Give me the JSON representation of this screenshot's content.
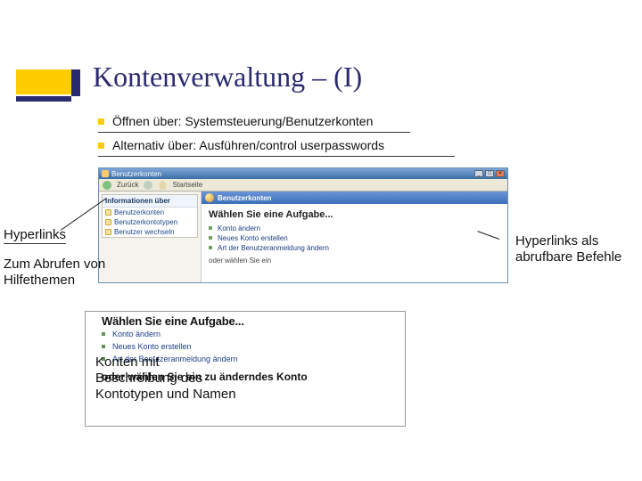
{
  "title": "Kontenverwaltung – (I)",
  "bullets": {
    "b1": "Öffnen über: Systemsteuerung/Benutzerkonten",
    "b2": "Alternativ über: Ausführen/control userpasswords"
  },
  "win1": {
    "title": "Benutzerkonten",
    "toolbar": {
      "back": "Zurück",
      "home": "Startseite"
    },
    "side": {
      "header": "Informationen über",
      "items": [
        "Benutzerkonten",
        "Benutzerkontotypen",
        "Benutzer wechseln"
      ]
    },
    "mainHeader": "Benutzerkonten",
    "tasksHeader": "Wählen Sie eine Aufgabe...",
    "tasks": [
      "Konto ändern",
      "Neues Konto erstellen",
      "Art der Benutzeranmeldung ändern"
    ],
    "orPrefix": "oder",
    "orRest": "wählen Sie ein"
  },
  "win2": {
    "headerOverlap": "Wählen Sie eine Aufgabe...",
    "tasks": [
      "Konto ändern",
      "Neues Konto erstellen",
      "Art der Benutzeranmeldung ändern"
    ],
    "or": "oder wählen Sie ein zu änderndes Konto"
  },
  "anno": {
    "hyperlinks": "Hyperlinks",
    "helpTopics": "Zum Abrufen von Hilfethemen",
    "right": "Hyperlinks als abrufbare Befehle",
    "accounts": "Konten mit Beschreibung des Kontotypen und Namen"
  }
}
